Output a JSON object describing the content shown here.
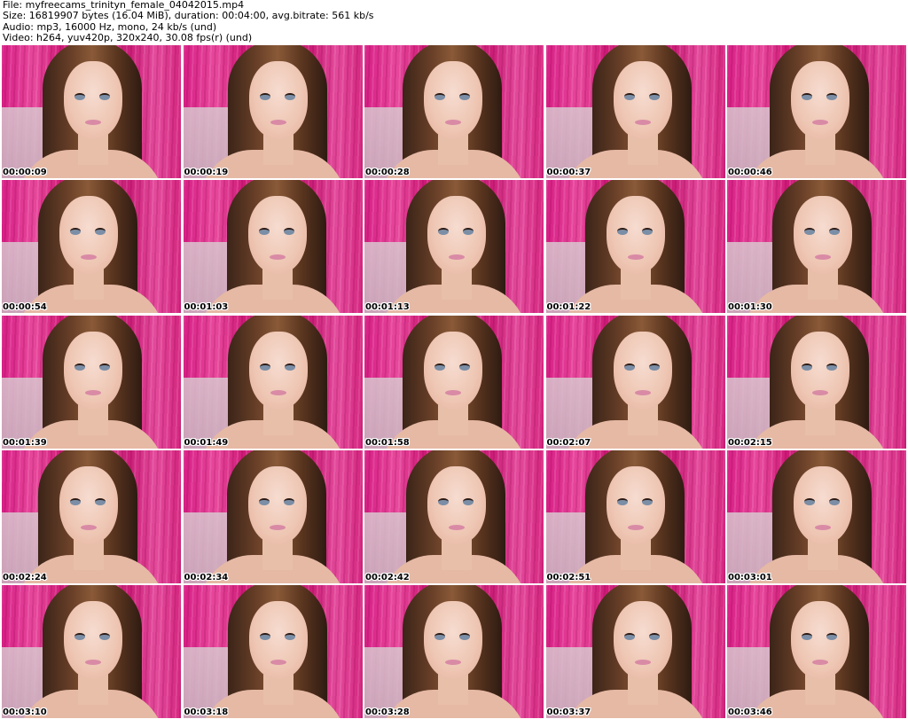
{
  "header": {
    "file_line": "File: myfreecams_trinityn_female_04042015.mp4",
    "size_line": "Size: 16819907 bytes (16.04 MiB), duration: 00:04:00, avg.bitrate: 561 kb/s",
    "audio_line": "Audio: mp3, 16000 Hz, mono, 24 kb/s (und)",
    "video_line": "Video: h264, yuv420p, 320x240, 30.08 fps(r) (und)"
  },
  "thumbnails": [
    {
      "timestamp": "00:00:09"
    },
    {
      "timestamp": "00:00:19"
    },
    {
      "timestamp": "00:00:28"
    },
    {
      "timestamp": "00:00:37"
    },
    {
      "timestamp": "00:00:46"
    },
    {
      "timestamp": "00:00:54"
    },
    {
      "timestamp": "00:01:03"
    },
    {
      "timestamp": "00:01:13"
    },
    {
      "timestamp": "00:01:22"
    },
    {
      "timestamp": "00:01:30"
    },
    {
      "timestamp": "00:01:39"
    },
    {
      "timestamp": "00:01:49"
    },
    {
      "timestamp": "00:01:58"
    },
    {
      "timestamp": "00:02:07"
    },
    {
      "timestamp": "00:02:15"
    },
    {
      "timestamp": "00:02:24"
    },
    {
      "timestamp": "00:02:34"
    },
    {
      "timestamp": "00:02:42"
    },
    {
      "timestamp": "00:02:51"
    },
    {
      "timestamp": "00:03:01"
    },
    {
      "timestamp": "00:03:10"
    },
    {
      "timestamp": "00:03:18"
    },
    {
      "timestamp": "00:03:28"
    },
    {
      "timestamp": "00:03:37"
    },
    {
      "timestamp": "00:03:46"
    }
  ],
  "colors": {
    "background": "#ffffff",
    "curtain": "#d81f86",
    "timestamp_text": "#000000"
  }
}
